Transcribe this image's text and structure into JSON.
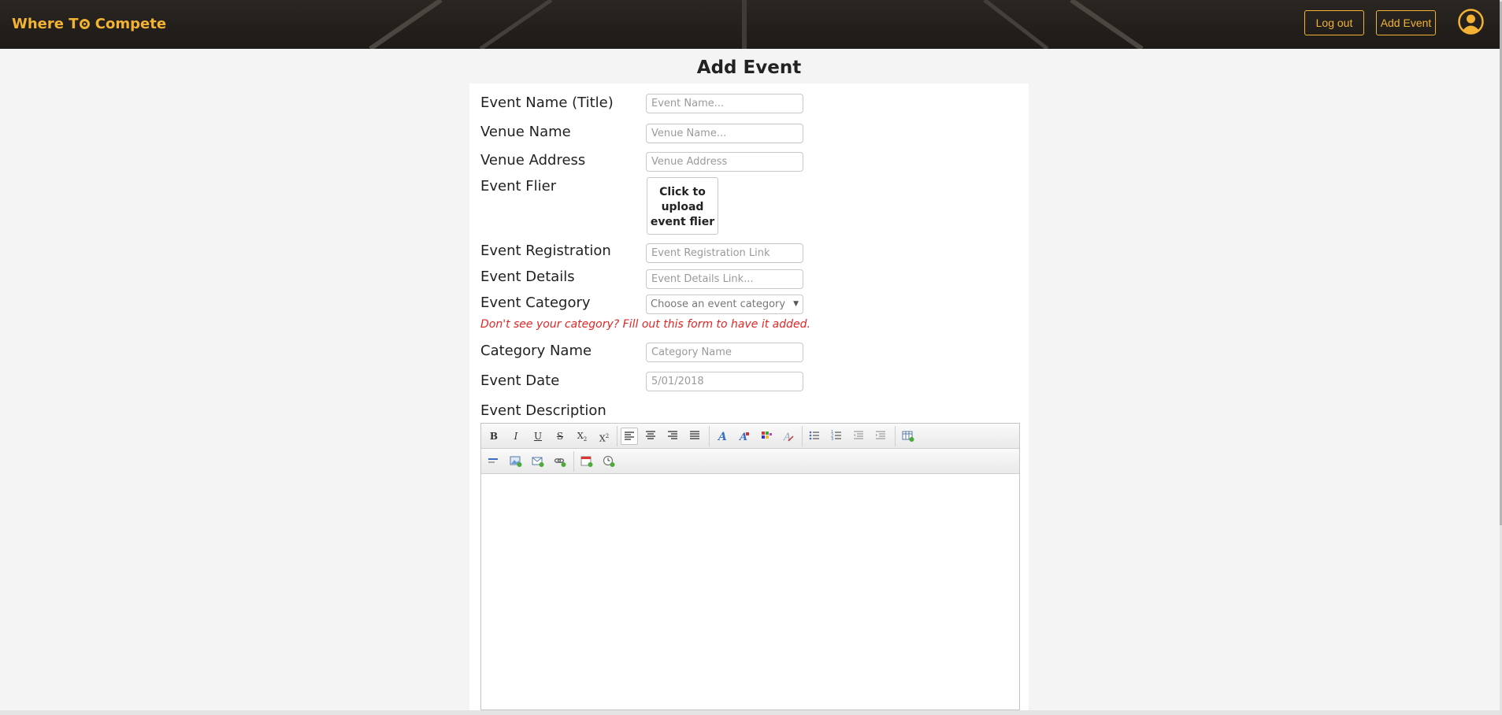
{
  "header": {
    "brand_part1": "Where T",
    "brand_part2": "Compete",
    "logout_label": "Log out",
    "add_event_label": "Add Event",
    "accent_color": "#f2b233"
  },
  "page": {
    "title": "Add Event"
  },
  "form": {
    "event_name": {
      "label": "Event Name (Title)",
      "placeholder": "Event Name..."
    },
    "venue_name": {
      "label": "Venue Name",
      "placeholder": "Venue Name..."
    },
    "venue_address": {
      "label": "Venue Address",
      "placeholder": "Venue Address"
    },
    "event_flier": {
      "label": "Event Flier",
      "upload_text": "Click to upload event flier"
    },
    "event_registration": {
      "label": "Event Registration",
      "placeholder": "Event Registration Link"
    },
    "event_details": {
      "label": "Event Details",
      "placeholder": "Event Details Link..."
    },
    "event_category": {
      "label": "Event Category",
      "selected": "Choose an event category"
    },
    "category_hint": "Don't see your category? Fill out this form to have it added.",
    "hint_color": "#e02626",
    "category_name": {
      "label": "Category Name",
      "placeholder": "Category Name"
    },
    "event_date": {
      "label": "Event Date",
      "placeholder": "5/01/2018"
    },
    "event_description": {
      "label": "Event Description"
    }
  },
  "editor": {
    "row1": [
      "bold-icon",
      "italic-icon",
      "underline-icon",
      "strikethrough-icon",
      "subscript-icon",
      "superscript-icon",
      "align-left-icon",
      "align-center-icon",
      "align-right-icon",
      "justify-icon",
      "font-style-icon",
      "font-size-icon",
      "color-palette-icon",
      "clear-formatting-icon",
      "bulleted-list-icon",
      "numbered-list-icon",
      "outdent-icon",
      "indent-icon",
      "insert-table-icon"
    ],
    "row2": [
      "horizontal-rule-icon",
      "insert-image-icon",
      "insert-email-icon",
      "insert-link-icon",
      "insert-date-icon",
      "insert-time-icon"
    ],
    "glyphs": {
      "bold": "B",
      "italic": "I",
      "underline": "U",
      "strike": "S",
      "sub": "X",
      "sup": "X"
    }
  }
}
